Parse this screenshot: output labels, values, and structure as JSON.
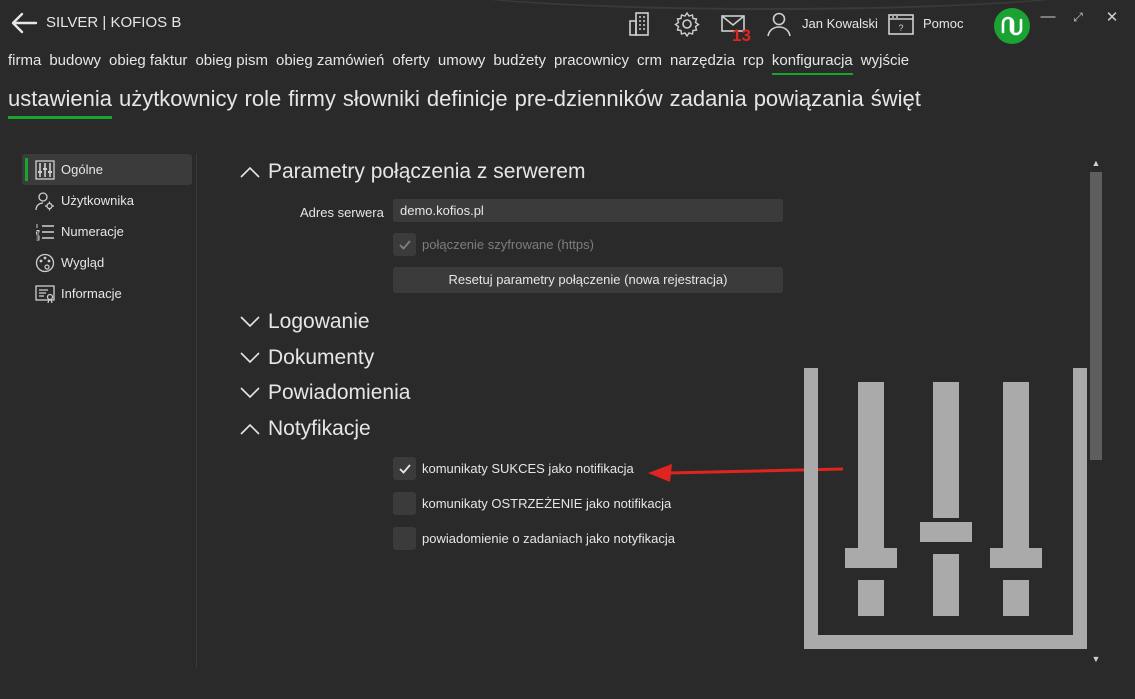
{
  "titlebar": {
    "title": "SILVER | KOFIOS B",
    "mail_count": "13",
    "user_name": "Jan Kowalski",
    "help_label": "Pomoc",
    "icons": [
      "back-arrow-icon",
      "building-icon",
      "gear-icon",
      "mail-icon",
      "user-icon",
      "help-icon",
      "logo-icon",
      "minimize-icon",
      "maximize-icon",
      "close-icon"
    ]
  },
  "main_menu": {
    "items": [
      "firma",
      "budowy",
      "obieg faktur",
      "obieg pism",
      "obieg zamówień",
      "oferty",
      "umowy",
      "budżety",
      "pracownicy",
      "crm",
      "narzędzia",
      "rcp",
      "konfiguracja",
      "wyjście"
    ],
    "active": "konfiguracja"
  },
  "sub_menu": {
    "items": [
      "ustawienia",
      "użytkownicy",
      "role",
      "firmy",
      "słowniki",
      "definicje",
      "pre-dzienników",
      "zadania",
      "powiązania",
      "święt"
    ],
    "active": "ustawienia"
  },
  "sidebar": {
    "items": [
      {
        "label": "Ogólne",
        "icon": "sliders-icon",
        "active": true
      },
      {
        "label": "Użytkownika",
        "icon": "user-gear-icon",
        "active": false
      },
      {
        "label": "Numeracje",
        "icon": "numbered-list-icon",
        "active": false
      },
      {
        "label": "Wygląd",
        "icon": "palette-icon",
        "active": false
      },
      {
        "label": "Informacje",
        "icon": "info-card-icon",
        "active": false
      }
    ]
  },
  "sections": {
    "connection": {
      "title": "Parametry połączenia z serwerem",
      "expanded": true,
      "server_label": "Adres serwera",
      "server_value": "demo.kofios.pl",
      "https_label": "połączenie szyfrowane (https)",
      "https_checked": true,
      "https_disabled": true,
      "reset_label": "Resetuj parametry połączenie (nowa rejestracja)"
    },
    "logging": {
      "title": "Logowanie",
      "expanded": false
    },
    "documents": {
      "title": "Dokumenty",
      "expanded": false
    },
    "alerts": {
      "title": "Powiadomienia",
      "expanded": false
    },
    "notifications": {
      "title": "Notyfikacje",
      "expanded": true,
      "options": [
        {
          "label": "komunikaty SUKCES jako notifikacja",
          "checked": true
        },
        {
          "label": "komunikaty OSTRZEŻENIE jako notifikacja",
          "checked": false
        },
        {
          "label": "powiadomienie o zadaniach jako notyfikacja",
          "checked": false
        }
      ]
    }
  },
  "colors": {
    "background": "#2a2a2a",
    "accent": "#17a52b",
    "field": "#3b3b3b",
    "badge": "#e0241f",
    "annotation_arrow": "#e0241f"
  }
}
